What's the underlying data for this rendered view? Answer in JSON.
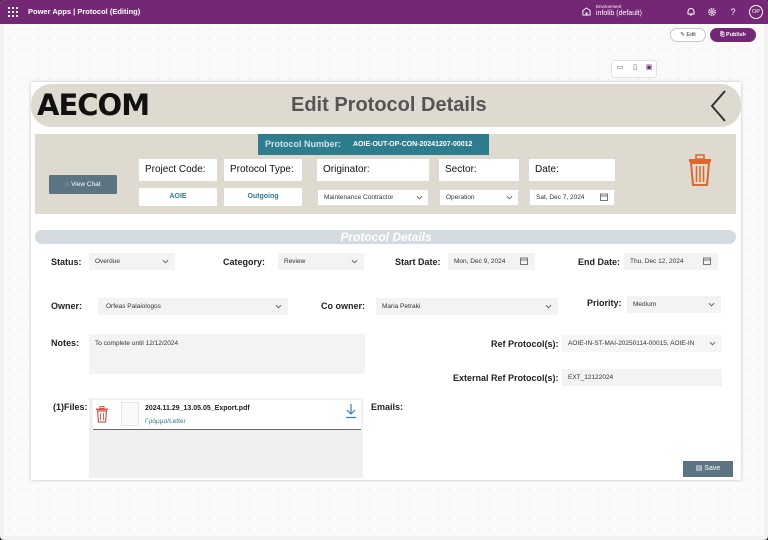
{
  "topbar": {
    "app_title": "Power Apps  |  Protocol (Editing)",
    "environment_label": "Environment",
    "environment_value": "infolib (default)",
    "avatar_initials": "OP",
    "icons": [
      "app-launcher-icon",
      "environment-icon",
      "bell-icon",
      "gear-icon",
      "help-icon"
    ]
  },
  "studio": {
    "edit_label": "Edit",
    "publish_label": "Publish",
    "accent_color": "#742774"
  },
  "header": {
    "logo_text": "AECOM",
    "title": "Edit Protocol Details"
  },
  "protocol_card": {
    "number_label": "Protocol Number:",
    "number_value": "AOIE-OUT-OP-CON-20241207-00012",
    "view_chat_label": "View Chat",
    "project_code_label": "Project Code:",
    "project_code_value": "AOIE",
    "protocol_type_label": "Protocol Type:",
    "protocol_type_value": "Outgoing",
    "originator_label": "Originator:",
    "originator_value": "Maintenance Contractor",
    "sector_label": "Sector:",
    "sector_value": "Operation",
    "date_label": "Date:",
    "date_value": "Sat, Dec 7, 2024"
  },
  "details": {
    "section_title": "Protocol Details",
    "status_label": "Status:",
    "status_value": "Overdue",
    "category_label": "Category:",
    "category_value": "Review",
    "start_date_label": "Start Date:",
    "start_date_value": "Mon, Dec 9, 2024",
    "end_date_label": "End Date:",
    "end_date_value": "Thu, Dec 12, 2024",
    "owner_label": "Owner:",
    "owner_value": "Orfeas Palaiologos",
    "co_owner_label": "Co owner:",
    "co_owner_value": "Maria Petraki",
    "priority_label": "Priority:",
    "priority_value": "Medium",
    "notes_label": "Notes:",
    "notes_value": "To complete until 12/12/2024",
    "ref_label": "Ref Protocol(s):",
    "ref_value": "AOIE-IN-ST-MAI-20250114-00015, AOIE-IN",
    "ext_ref_label": "External Ref Protocol(s):",
    "ext_ref_value": "EXT_12122024",
    "files_label": "(1)Files:",
    "file_name": "2024.11.29_13.05.05_Export.pdf",
    "file_subtitle": "Γράμμα/Letter",
    "emails_label": "Emails:",
    "save_label": "Save"
  }
}
